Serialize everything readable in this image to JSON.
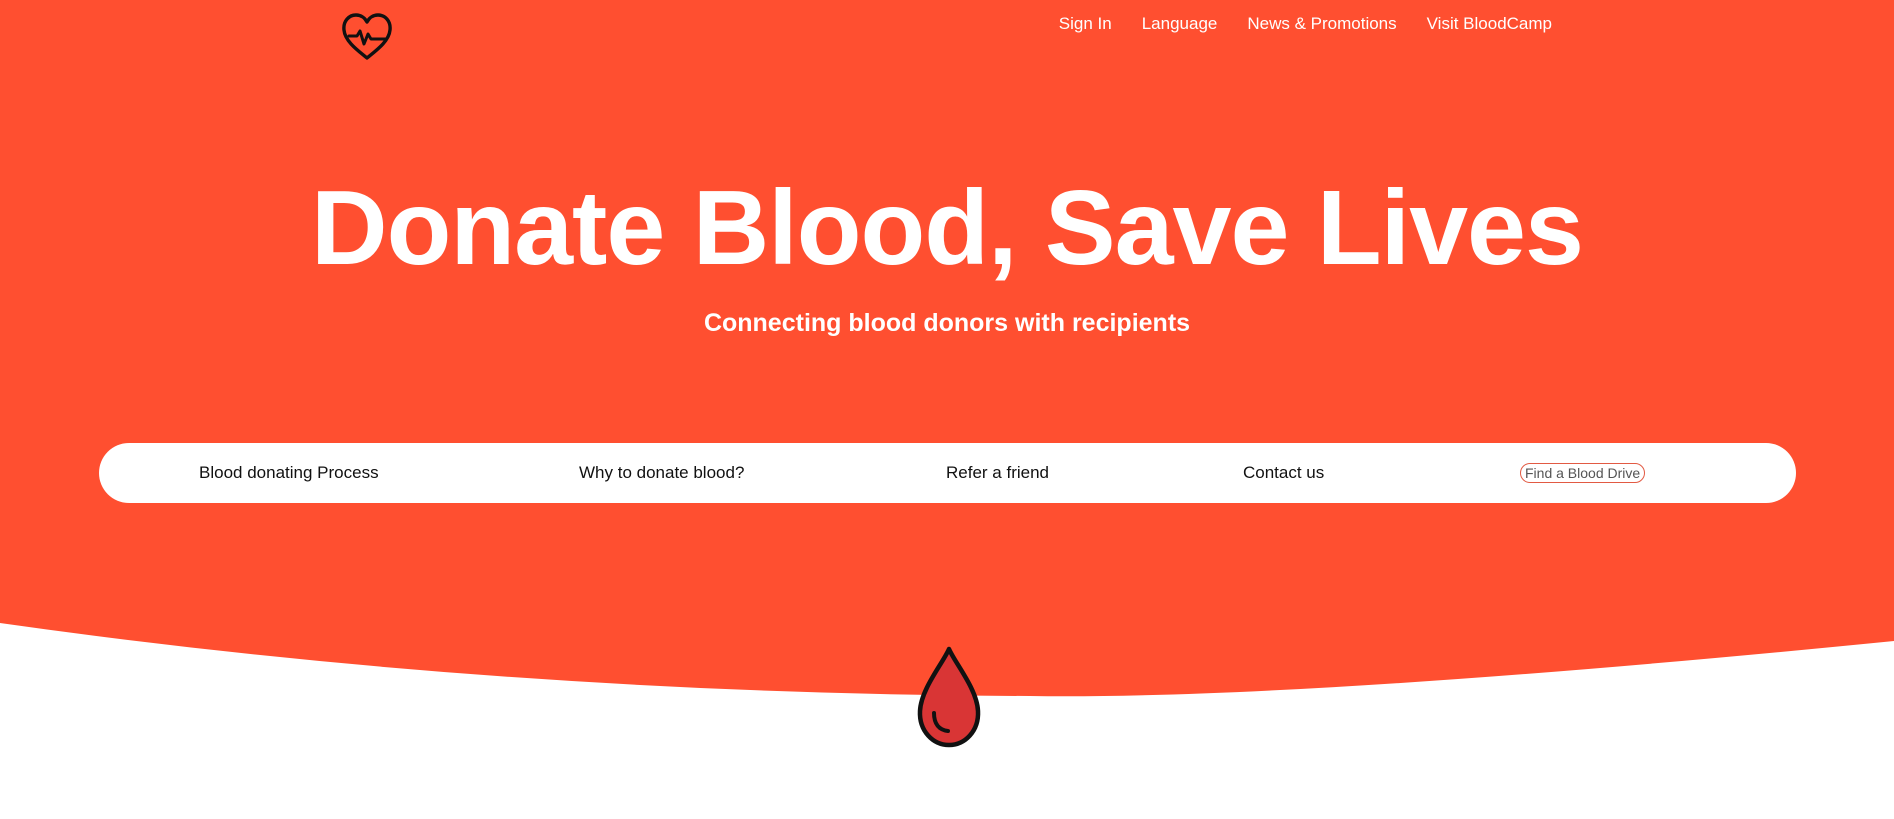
{
  "colors": {
    "brand": "#ff4f30",
    "drop_fill": "#d93535",
    "outline": "#111111"
  },
  "header": {
    "logo_icon": "heart-pulse-icon",
    "nav": [
      {
        "label": "Sign In"
      },
      {
        "label": "Language"
      },
      {
        "label": "News & Promotions"
      },
      {
        "label": "Visit BloodCamp"
      }
    ]
  },
  "hero": {
    "title": "Donate Blood, Save Lives",
    "subtitle": "Connecting blood donors with recipients"
  },
  "main_nav": {
    "items": [
      {
        "label": "Blood donating Process"
      },
      {
        "label": "Why to donate blood?"
      },
      {
        "label": "Refer a friend"
      },
      {
        "label": "Contact us"
      }
    ],
    "cta": "Find a Blood Drive"
  },
  "decoration": {
    "drop_icon": "blood-drop-icon"
  }
}
